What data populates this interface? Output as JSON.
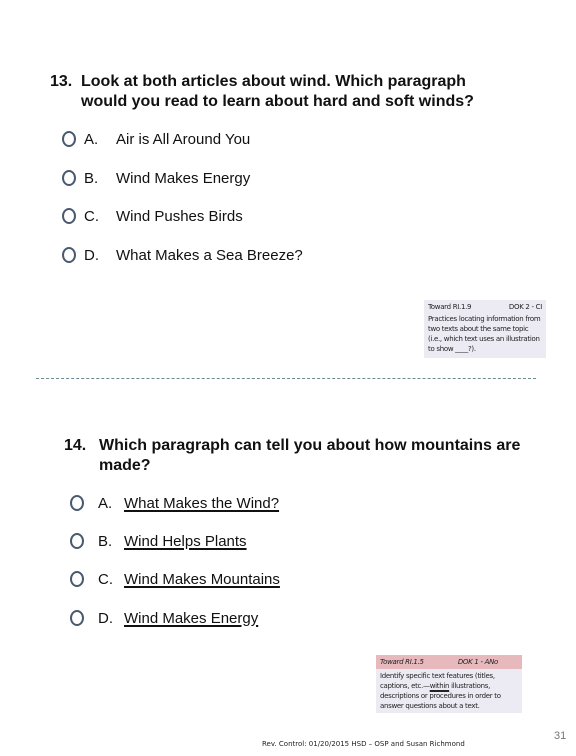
{
  "questions": [
    {
      "number": "13.",
      "line1": "Look at both articles about wind. Which paragraph",
      "line2": "would you read to learn about hard and soft winds?",
      "options": [
        {
          "letter": "A.",
          "text": "Air is All Around You"
        },
        {
          "letter": "B.",
          "text": "Wind Makes Energy"
        },
        {
          "letter": "C.",
          "text": "Wind Pushes Birds"
        },
        {
          "letter": "D.",
          "text": "What Makes a Sea Breeze?"
        }
      ],
      "standard": {
        "code": "Toward RI.1.9",
        "dok": "DOK 2 - CI",
        "description": "Practices locating information from two texts about the same topic (i.e., which text uses an illustration to show ____?).",
        "header_color": "#ecebf4"
      }
    },
    {
      "number": "14.",
      "line1": "Which paragraph can tell you about how mountains are",
      "line2": "made?",
      "options": [
        {
          "letter": "A.",
          "text": "What Makes the Wind?"
        },
        {
          "letter": "B.",
          "text": "Wind Helps Plants"
        },
        {
          "letter": "C.",
          "text": "Wind Makes Mountains"
        },
        {
          "letter": "D.",
          "text": "Wind Makes Energy"
        }
      ],
      "standard": {
        "code": "Toward RI.1.5",
        "dok": "DOK 1 - ANo",
        "description_pre": "Identify specific text features (titles, captions, etc.—",
        "description_u": "within",
        "description_post": " illustrations, descriptions or procedures in order to answer questions about a text.",
        "header_color": "#e7b9bd"
      }
    }
  ],
  "footer": {
    "text": "Rev. Control:  01/20/2015  HSD – OSP and Susan Richmond",
    "page_number": "31"
  }
}
